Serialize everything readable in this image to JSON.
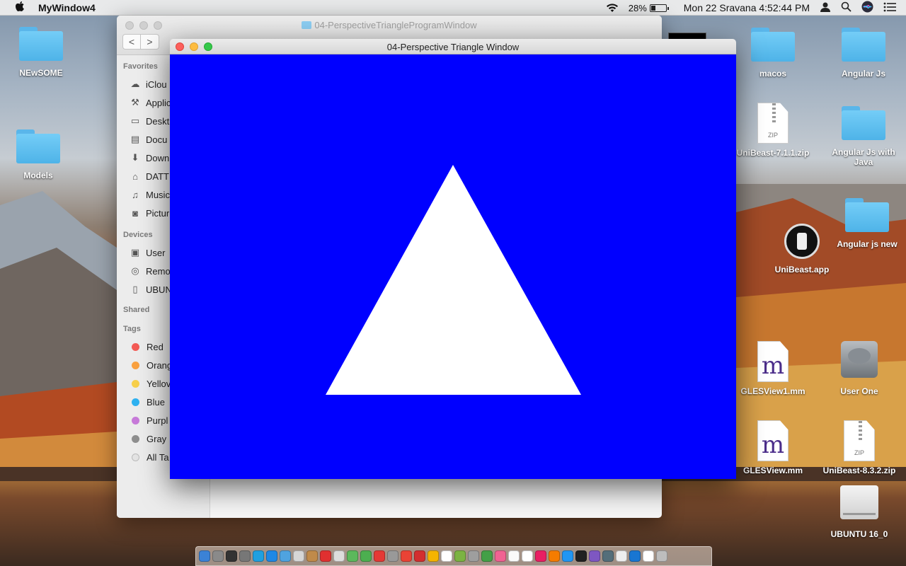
{
  "menubar": {
    "apple_icon": "apple-icon",
    "app_name": "MyWindow4",
    "battery_percent": "28%",
    "battery_level": 0.28,
    "datetime": "Mon 22 Sravana  4:52:44 PM"
  },
  "desktop_icons": [
    {
      "label": "NEwSOME",
      "kind": "folder"
    },
    {
      "label": "Models",
      "kind": "folder"
    },
    {
      "label": "macos",
      "kind": "folder"
    },
    {
      "label": "Angular Js",
      "kind": "folder"
    },
    {
      "label": "UniBeast-7.1.1.zip",
      "kind": "zip",
      "badge": "ZIP"
    },
    {
      "label": "Angular Js with Java",
      "kind": "folder"
    },
    {
      "label": "Angular js new",
      "kind": "folder"
    },
    {
      "label": "UniBeast.app",
      "kind": "app"
    },
    {
      "label": "GLESView1.mm",
      "kind": "mm",
      "glyph": "m"
    },
    {
      "label": "User One",
      "kind": "disk"
    },
    {
      "label": "GLESView.mm",
      "kind": "mm",
      "glyph": "m"
    },
    {
      "label": "UniBeast-8.3.2.zip",
      "kind": "zip",
      "badge": "ZIP"
    },
    {
      "label": "UBUNTU 16_0",
      "kind": "drive"
    }
  ],
  "finder": {
    "title": "04-PerspectiveTriangleProgramWindow",
    "nav_back": "<",
    "nav_forward": ">",
    "sidebar": {
      "favorites_header": "Favorites",
      "favorites": [
        {
          "label": "iClou",
          "icon": "cloud-icon"
        },
        {
          "label": "Applic",
          "icon": "applications-icon"
        },
        {
          "label": "Deskt",
          "icon": "desktop-icon"
        },
        {
          "label": "Docu",
          "icon": "document-icon"
        },
        {
          "label": "Down",
          "icon": "download-icon"
        },
        {
          "label": "DATT",
          "icon": "home-icon"
        },
        {
          "label": "Music",
          "icon": "music-icon"
        },
        {
          "label": "Pictur",
          "icon": "camera-icon"
        }
      ],
      "devices_header": "Devices",
      "devices": [
        {
          "label": "User",
          "icon": "drive-icon"
        },
        {
          "label": "Remo",
          "icon": "disc-icon"
        },
        {
          "label": "UBUN",
          "icon": "usb-drive-icon"
        }
      ],
      "shared_header": "Shared",
      "tags_header": "Tags",
      "tags": [
        {
          "label": "Red",
          "color": "#f35a55"
        },
        {
          "label": "Orang",
          "color": "#f9a03f"
        },
        {
          "label": "Yellov",
          "color": "#f7cf4a"
        },
        {
          "label": "Blue",
          "color": "#2eb1f0"
        },
        {
          "label": "Purpl",
          "color": "#c77ad9"
        },
        {
          "label": "Gray",
          "color": "#8e8e8e"
        },
        {
          "label": "All Ta",
          "color": "#e3e3e3"
        }
      ]
    }
  },
  "gl_window": {
    "title": "04-Perspective Triangle Window",
    "clear_color": "#0000ff",
    "triangle_color": "#ffffff",
    "traffic_lights": {
      "close": "#fc605c",
      "minimize": "#fdbc40",
      "zoom": "#34c84a"
    }
  },
  "dock": {
    "colors": [
      "#3b82d6",
      "#8a8a8a",
      "#333333",
      "#777777",
      "#1fa0e0",
      "#1e88e5",
      "#4fa3e0",
      "#d6d6d6",
      "#c08a4a",
      "#e03030",
      "#dddddd",
      "#5cb85c",
      "#4caf50",
      "#e53935",
      "#999999",
      "#ea4335",
      "#d32f2f",
      "#f5b400",
      "#ffffff",
      "#7cb342",
      "#9e9e9e",
      "#43a047",
      "#f06292",
      "#fafafa",
      "#ffffff",
      "#e91e63",
      "#f57c00",
      "#2196f3",
      "#212121",
      "#7e57c2",
      "#546e7a",
      "#eeeeee",
      "#1976d2",
      "#ffffff",
      "#bdbdbd"
    ]
  }
}
